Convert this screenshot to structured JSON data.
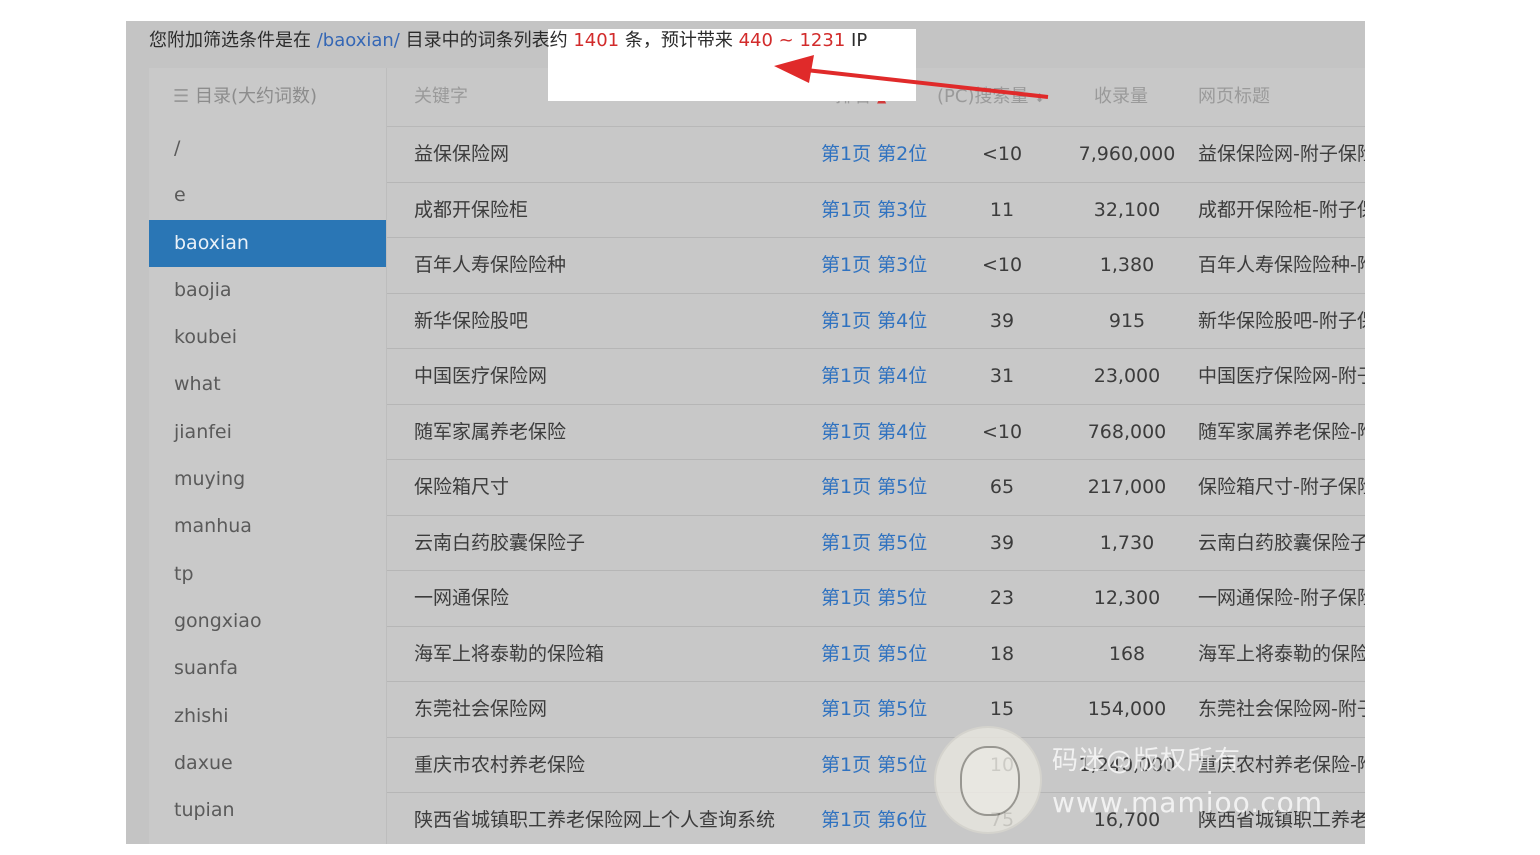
{
  "summary": {
    "prefix": "您附加筛选条件是在 ",
    "dir_link": "/baoxian/",
    "middle": " 目录中的词条列表约 ",
    "count": "1401",
    "count_suffix": " 条，预计带来 ",
    "ip_min": "440",
    "range_sep": " ~ ",
    "ip_max": "1231",
    "ip_suffix": " IP"
  },
  "sidebar": {
    "header": "目录(大约词数)",
    "items": [
      {
        "label": "/"
      },
      {
        "label": "e"
      },
      {
        "label": "baoxian",
        "active": true
      },
      {
        "label": "baojia"
      },
      {
        "label": "koubei"
      },
      {
        "label": "what"
      },
      {
        "label": "jianfei"
      },
      {
        "label": "muying"
      },
      {
        "label": "manhua"
      },
      {
        "label": "tp"
      },
      {
        "label": "gongxiao"
      },
      {
        "label": "suanfa"
      },
      {
        "label": "zhishi"
      },
      {
        "label": "daxue"
      },
      {
        "label": "tupian"
      }
    ]
  },
  "table": {
    "columns": {
      "keyword": "关键字",
      "rank": "排名",
      "pc": "(PC)搜索量",
      "indexed": "收录量",
      "title": "网页标题"
    },
    "rows": [
      {
        "keyword": "益保保险网",
        "rank": "第1页 第2位",
        "pc": "<10",
        "indexed": "7,960,000",
        "title": "益保保险网-附子保险"
      },
      {
        "keyword": "成都开保险柜",
        "rank": "第1页 第3位",
        "pc": "11",
        "indexed": "32,100",
        "title": "成都开保险柜-附子保"
      },
      {
        "keyword": "百年人寿保险险种",
        "rank": "第1页 第3位",
        "pc": "<10",
        "indexed": "1,380",
        "title": "百年人寿保险险种-附"
      },
      {
        "keyword": "新华保险股吧",
        "rank": "第1页 第4位",
        "pc": "39",
        "indexed": "915",
        "title": "新华保险股吧-附子保"
      },
      {
        "keyword": "中国医疗保险网",
        "rank": "第1页 第4位",
        "pc": "31",
        "indexed": "23,000",
        "title": "中国医疗保险网-附子"
      },
      {
        "keyword": "随军家属养老保险",
        "rank": "第1页 第4位",
        "pc": "<10",
        "indexed": "768,000",
        "title": "随军家属养老保险-附"
      },
      {
        "keyword": "保险箱尺寸",
        "rank": "第1页 第5位",
        "pc": "65",
        "indexed": "217,000",
        "title": "保险箱尺寸-附子保险"
      },
      {
        "keyword": "云南白药胶囊保险子",
        "rank": "第1页 第5位",
        "pc": "39",
        "indexed": "1,730",
        "title": "云南白药胶囊保险子-"
      },
      {
        "keyword": "一网通保险",
        "rank": "第1页 第5位",
        "pc": "23",
        "indexed": "12,300",
        "title": "一网通保险-附子保险"
      },
      {
        "keyword": "海军上将泰勒的保险箱",
        "rank": "第1页 第5位",
        "pc": "18",
        "indexed": "168",
        "title": "海军上将泰勒的保险箱"
      },
      {
        "keyword": "东莞社会保险网",
        "rank": "第1页 第5位",
        "pc": "15",
        "indexed": "154,000",
        "title": "东莞社会保险网-附子"
      },
      {
        "keyword": "重庆市农村养老保险",
        "rank": "第1页 第5位",
        "pc": "10",
        "indexed": "1,240,000",
        "title": "重庆农村养老保险-附"
      },
      {
        "keyword": "陕西省城镇职工养老保险网上个人查询系统",
        "rank": "第1页 第6位",
        "pc": "75",
        "indexed": "16,700",
        "title": "陕西省城镇职工养老"
      }
    ]
  },
  "watermark": {
    "line1": "码迷@版权所有",
    "line2": "www.mamioo.com"
  },
  "icons": {
    "menu": "list-icon",
    "sort": "sort-icon",
    "annotation": "red-arrow"
  },
  "colors": {
    "active_bg": "#2a76b5",
    "link": "#2f72c0",
    "highlight_number": "#d22b2b",
    "arrow": "#e02a2a"
  }
}
